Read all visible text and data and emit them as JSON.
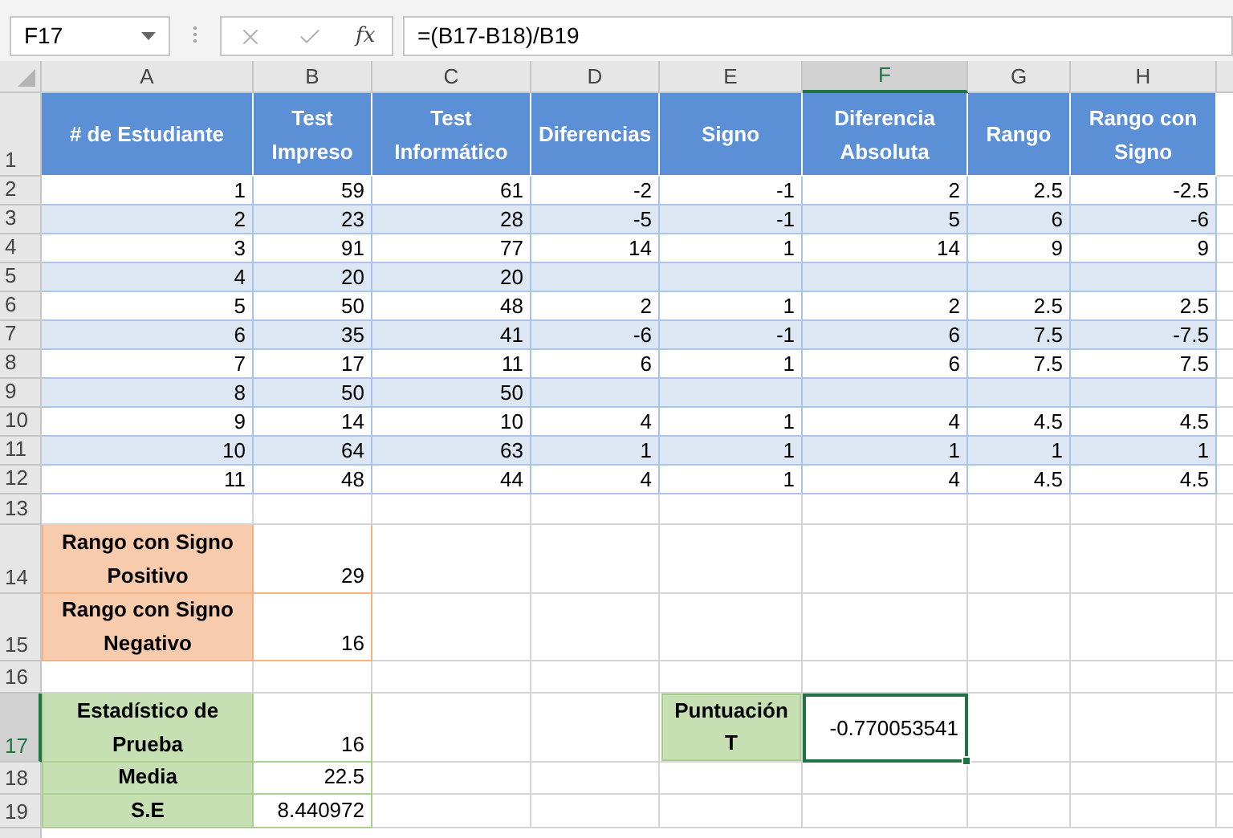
{
  "formula_bar": {
    "name_box": "F17",
    "function_button": "fx",
    "formula": "=(B17-B18)/B19"
  },
  "columns": [
    {
      "label": "A",
      "selected": false
    },
    {
      "label": "B",
      "selected": false
    },
    {
      "label": "C",
      "selected": false
    },
    {
      "label": "D",
      "selected": false
    },
    {
      "label": "E",
      "selected": false
    },
    {
      "label": "F",
      "selected": true
    },
    {
      "label": "G",
      "selected": false
    },
    {
      "label": "H",
      "selected": false
    }
  ],
  "row_numbers": [
    {
      "label": "1",
      "selected": false
    },
    {
      "label": "2",
      "selected": false
    },
    {
      "label": "3",
      "selected": false
    },
    {
      "label": "4",
      "selected": false
    },
    {
      "label": "5",
      "selected": false
    },
    {
      "label": "6",
      "selected": false
    },
    {
      "label": "7",
      "selected": false
    },
    {
      "label": "8",
      "selected": false
    },
    {
      "label": "9",
      "selected": false
    },
    {
      "label": "10",
      "selected": false
    },
    {
      "label": "11",
      "selected": false
    },
    {
      "label": "12",
      "selected": false
    },
    {
      "label": "13",
      "selected": false
    },
    {
      "label": "14",
      "selected": false
    },
    {
      "label": "15",
      "selected": false
    },
    {
      "label": "16",
      "selected": false
    },
    {
      "label": "17",
      "selected": true
    },
    {
      "label": "18",
      "selected": false
    },
    {
      "label": "19",
      "selected": false
    }
  ],
  "table": {
    "header": [
      "# de Estudiante",
      "Test Impreso",
      "Test Informático",
      "Diferencias",
      "Signo",
      "Diferencia Absoluta",
      "Rango",
      "Rango con Signo"
    ],
    "rows": [
      [
        "1",
        "59",
        "61",
        "-2",
        "-1",
        "2",
        "2.5",
        "-2.5"
      ],
      [
        "2",
        "23",
        "28",
        "-5",
        "-1",
        "5",
        "6",
        "-6"
      ],
      [
        "3",
        "91",
        "77",
        "14",
        "1",
        "14",
        "9",
        "9"
      ],
      [
        "4",
        "20",
        "20",
        null,
        null,
        null,
        null,
        null
      ],
      [
        "5",
        "50",
        "48",
        "2",
        "1",
        "2",
        "2.5",
        "2.5"
      ],
      [
        "6",
        "35",
        "41",
        "-6",
        "-1",
        "6",
        "7.5",
        "-7.5"
      ],
      [
        "7",
        "17",
        "11",
        "6",
        "1",
        "6",
        "7.5",
        "7.5"
      ],
      [
        "8",
        "50",
        "50",
        null,
        null,
        null,
        null,
        null
      ],
      [
        "9",
        "14",
        "10",
        "4",
        "1",
        "4",
        "4.5",
        "4.5"
      ],
      [
        "10",
        "64",
        "63",
        "1",
        "1",
        "1",
        "1",
        "1"
      ],
      [
        "11",
        "48",
        "44",
        "4",
        "1",
        "4",
        "4.5",
        "4.5"
      ]
    ]
  },
  "summary": [
    {
      "label": "Rango con Signo Positivo",
      "value": "29",
      "color": "#f8cbad"
    },
    {
      "label": "Rango con Signo Negativo",
      "value": "16",
      "color": "#f8cbad"
    },
    {
      "label": "Estadístico de Prueba",
      "value": "16",
      "color": "#c6e0b4"
    },
    {
      "label": "Media",
      "value": "22.5",
      "color": "#c6e0b4"
    },
    {
      "label": "S.E",
      "value": "8.440972",
      "color": "#c6e0b4"
    }
  ],
  "result": {
    "label": "Puntuación T",
    "value": "-0.770053541",
    "color": "#c6e0b4",
    "selected": true
  }
}
